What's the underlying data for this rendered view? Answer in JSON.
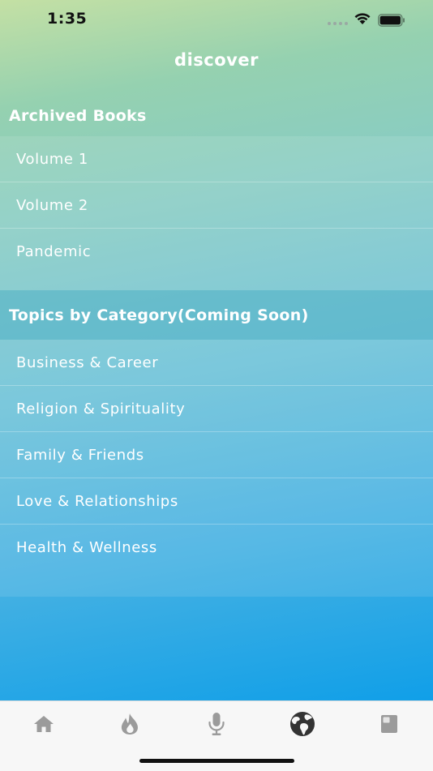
{
  "status_bar": {
    "time": "1:35"
  },
  "nav": {
    "title": "discover"
  },
  "sections": [
    {
      "header": "Archived Books",
      "items": [
        "Volume 1",
        "Volume 2",
        "Pandemic"
      ]
    },
    {
      "header": "Topics by Category(Coming Soon)",
      "items": [
        "Business & Career",
        "Religion & Spirituality",
        "Family & Friends",
        "Love & Relationships",
        "Health & Wellness"
      ]
    }
  ],
  "tab_bar": {
    "tabs": [
      {
        "icon": "home-icon",
        "active": false
      },
      {
        "icon": "fire-icon",
        "active": false
      },
      {
        "icon": "microphone-icon",
        "active": false
      },
      {
        "icon": "globe-icon",
        "active": true
      },
      {
        "icon": "book-icon",
        "active": false
      }
    ],
    "active_color": "#333333",
    "inactive_color": "#9b9b9b"
  }
}
